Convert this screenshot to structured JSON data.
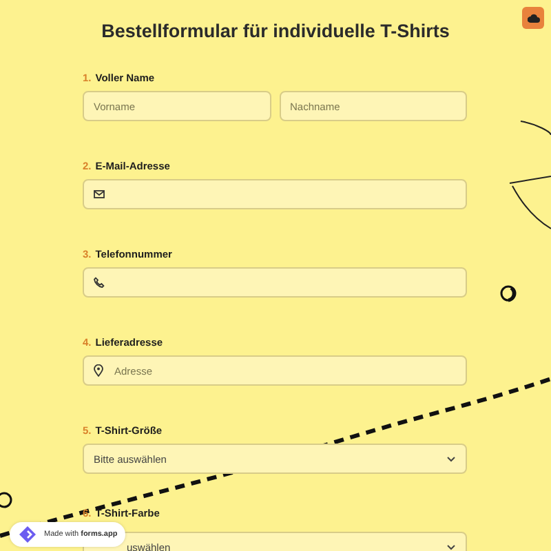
{
  "title": "Bestellformular für individuelle T-Shirts",
  "questions": [
    {
      "number": "1.",
      "label": "Voller Name",
      "kind": "name",
      "fields": [
        {
          "placeholder": "Vorname"
        },
        {
          "placeholder": "Nachname"
        }
      ]
    },
    {
      "number": "2.",
      "label": "E-Mail-Adresse",
      "kind": "email"
    },
    {
      "number": "3.",
      "label": "Telefonnummer",
      "kind": "phone"
    },
    {
      "number": "4.",
      "label": "Lieferadresse",
      "kind": "address",
      "fields": [
        {
          "placeholder": "Adresse"
        }
      ]
    },
    {
      "number": "5.",
      "label": "T-Shirt-Größe",
      "kind": "select",
      "fields": [
        {
          "value": "Bitte auswählen"
        }
      ]
    },
    {
      "number": "6.",
      "label": "T-Shirt-Farbe",
      "kind": "select",
      "fields": [
        {
          "value": "uswählen",
          "covered": true
        }
      ]
    }
  ],
  "badge": {
    "prefix": "Made with",
    "brand": "forms.app"
  }
}
